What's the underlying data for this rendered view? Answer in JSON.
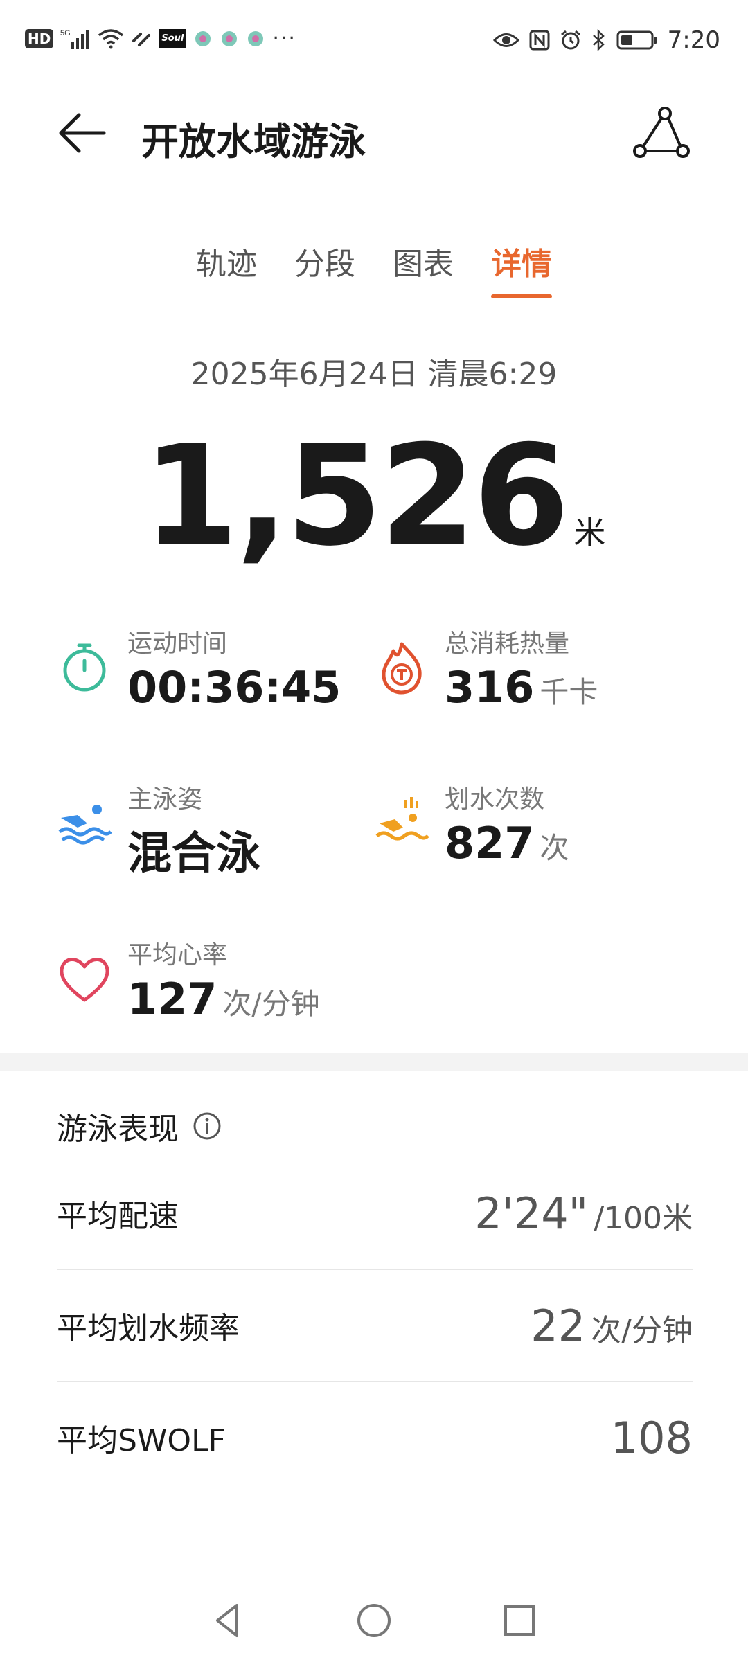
{
  "status_bar": {
    "left_badge": "HD",
    "network": "5G",
    "soul_label": "Soul",
    "more": "···",
    "time": "7:20"
  },
  "header": {
    "title": "开放水域游泳"
  },
  "tabs": [
    {
      "label": "轨迹",
      "active": false
    },
    {
      "label": "分段",
      "active": false
    },
    {
      "label": "图表",
      "active": false
    },
    {
      "label": "详情",
      "active": true
    }
  ],
  "session": {
    "datetime": "2025年6月24日 清晨6:29",
    "distance_value": "1,526",
    "distance_unit": "米"
  },
  "metrics": {
    "duration": {
      "label": "运动时间",
      "value": "00:36:45"
    },
    "calories": {
      "label": "总消耗热量",
      "value": "316",
      "unit": "千卡"
    },
    "stroke_type": {
      "label": "主泳姿",
      "value": "混合泳"
    },
    "stroke_count": {
      "label": "划水次数",
      "value": "827",
      "unit": "次"
    },
    "heart_rate": {
      "label": "平均心率",
      "value": "127",
      "unit": "次/分钟"
    }
  },
  "performance": {
    "title": "游泳表现",
    "rows": [
      {
        "label": "平均配速",
        "value": "2'24\"",
        "unit": "/100米"
      },
      {
        "label": "平均划水频率",
        "value": "22",
        "unit": "次/分钟"
      },
      {
        "label": "平均SWOLF",
        "value": "108",
        "unit": ""
      }
    ]
  },
  "colors": {
    "accent": "#E8672E",
    "timer_icon": "#3DBB9A",
    "calorie_icon": "#E0522F",
    "swim_icon": "#3B8FE8",
    "stroke_icon": "#F0A020",
    "heart_icon": "#E0455E"
  },
  "icons": {
    "back": "arrow-left-icon",
    "route": "route-share-icon",
    "info": "info-icon"
  }
}
